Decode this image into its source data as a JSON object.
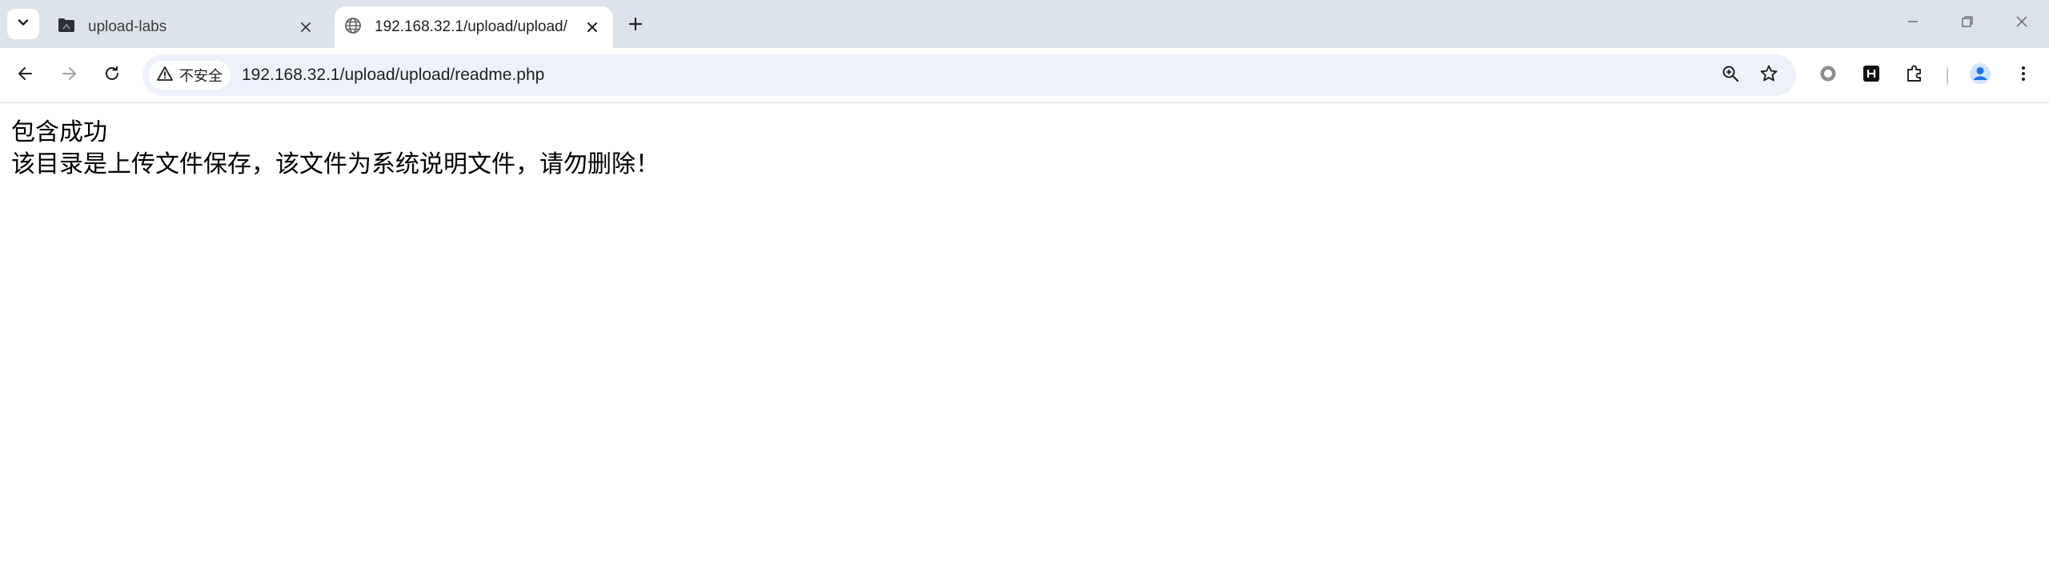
{
  "tabs": [
    {
      "title": "upload-labs",
      "active": false,
      "icon": "folder-favicon-icon"
    },
    {
      "title": "192.168.32.1/upload/upload/",
      "active": true,
      "icon": "globe-icon"
    }
  ],
  "omnibox": {
    "security_label": "不安全",
    "url": "192.168.32.1/upload/upload/readme.php"
  },
  "page": {
    "line1": "包含成功",
    "line2": "该目录是上传文件保存，该文件为系统说明文件，请勿删除！"
  },
  "colors": {
    "tabstrip_bg": "#dde3ea",
    "omnibox_bg": "#edf2fa",
    "profile_accent": "#1a73e8"
  }
}
